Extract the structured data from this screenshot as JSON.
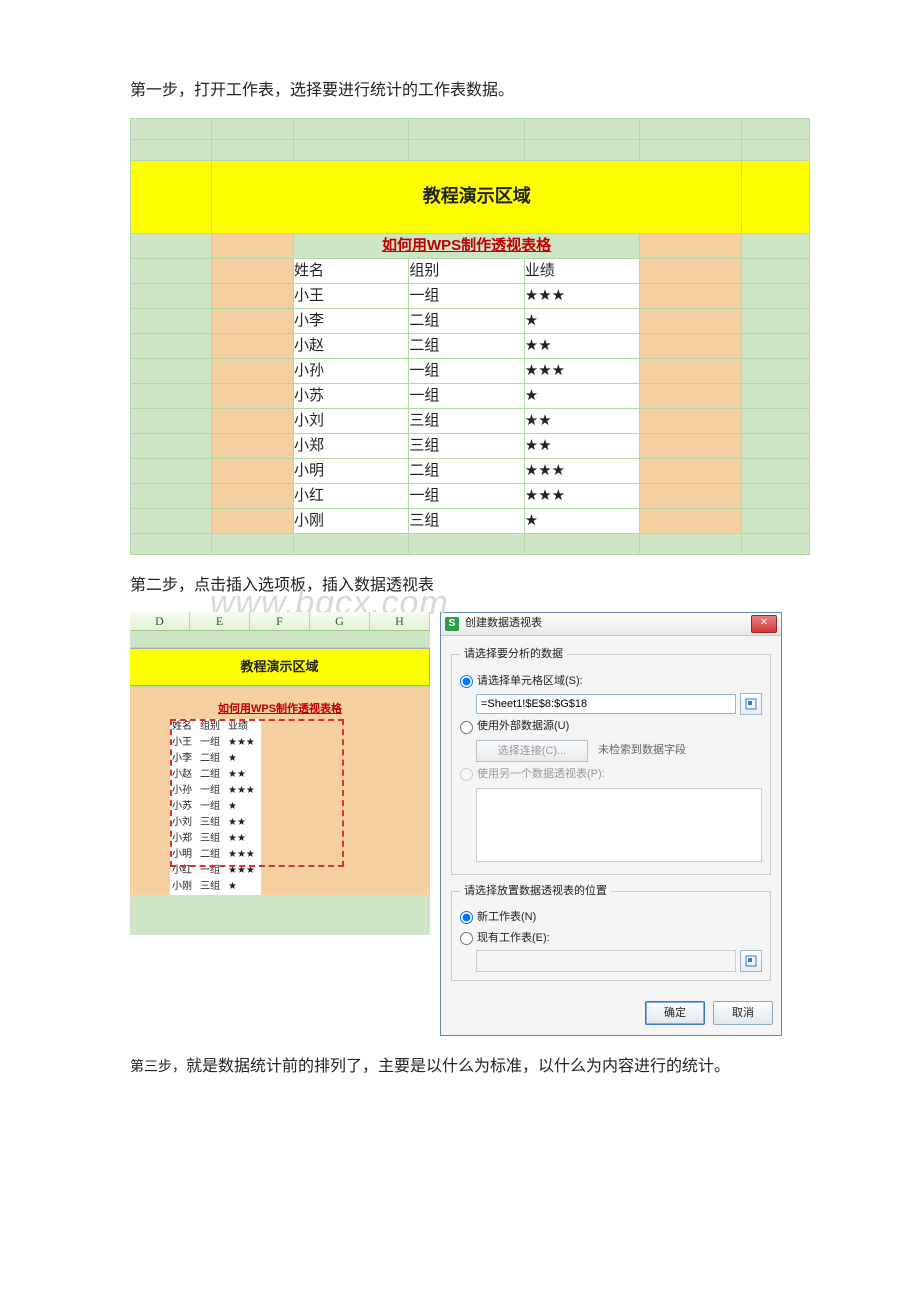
{
  "steps": {
    "s1": "第一步，打开工作表，选择要进行统计的工作表数据。",
    "s2": "第二步，点击插入选项板，插入数据透视表",
    "s3a": "第三步，",
    "s3b": "就是数据统计前的排列了，主要是以什么为标准，以什么为内容进行的统计。"
  },
  "watermark": "www.bgcx.com",
  "sheet": {
    "title": "教程演示区域",
    "subtitle": "如何用WPS制作透视表格",
    "headers": {
      "name": "姓名",
      "group": "组别",
      "perf": "业绩"
    },
    "rows": [
      {
        "name": "小王",
        "group": "一组",
        "stars": "★★★"
      },
      {
        "name": "小李",
        "group": "二组",
        "stars": "★"
      },
      {
        "name": "小赵",
        "group": "二组",
        "stars": "★★"
      },
      {
        "name": "小孙",
        "group": "一组",
        "stars": "★★★"
      },
      {
        "name": "小苏",
        "group": "一组",
        "stars": "★"
      },
      {
        "name": "小刘",
        "group": "三组",
        "stars": "★★"
      },
      {
        "name": "小郑",
        "group": "三组",
        "stars": "★★"
      },
      {
        "name": "小明",
        "group": "二组",
        "stars": "★★★"
      },
      {
        "name": "小红",
        "group": "一组",
        "stars": "★★★"
      },
      {
        "name": "小刚",
        "group": "三组",
        "stars": "★"
      }
    ]
  },
  "columns": [
    "D",
    "E",
    "F",
    "G",
    "H"
  ],
  "dialog": {
    "title": "创建数据透视表",
    "section1": "请选择要分析的数据",
    "opt_range": "请选择单元格区域(S):",
    "range_value": "=Sheet1!$E$8:$G$18",
    "opt_ext": "使用外部数据源(U)",
    "choose_conn": "选择连接(C)...",
    "no_field": "未检索到数据字段",
    "opt_other": "使用另一个数据透视表(P):",
    "section2": "请选择放置数据透视表的位置",
    "opt_new": "新工作表(N)",
    "opt_exist": "现有工作表(E):",
    "ok": "确定",
    "cancel": "取消"
  }
}
